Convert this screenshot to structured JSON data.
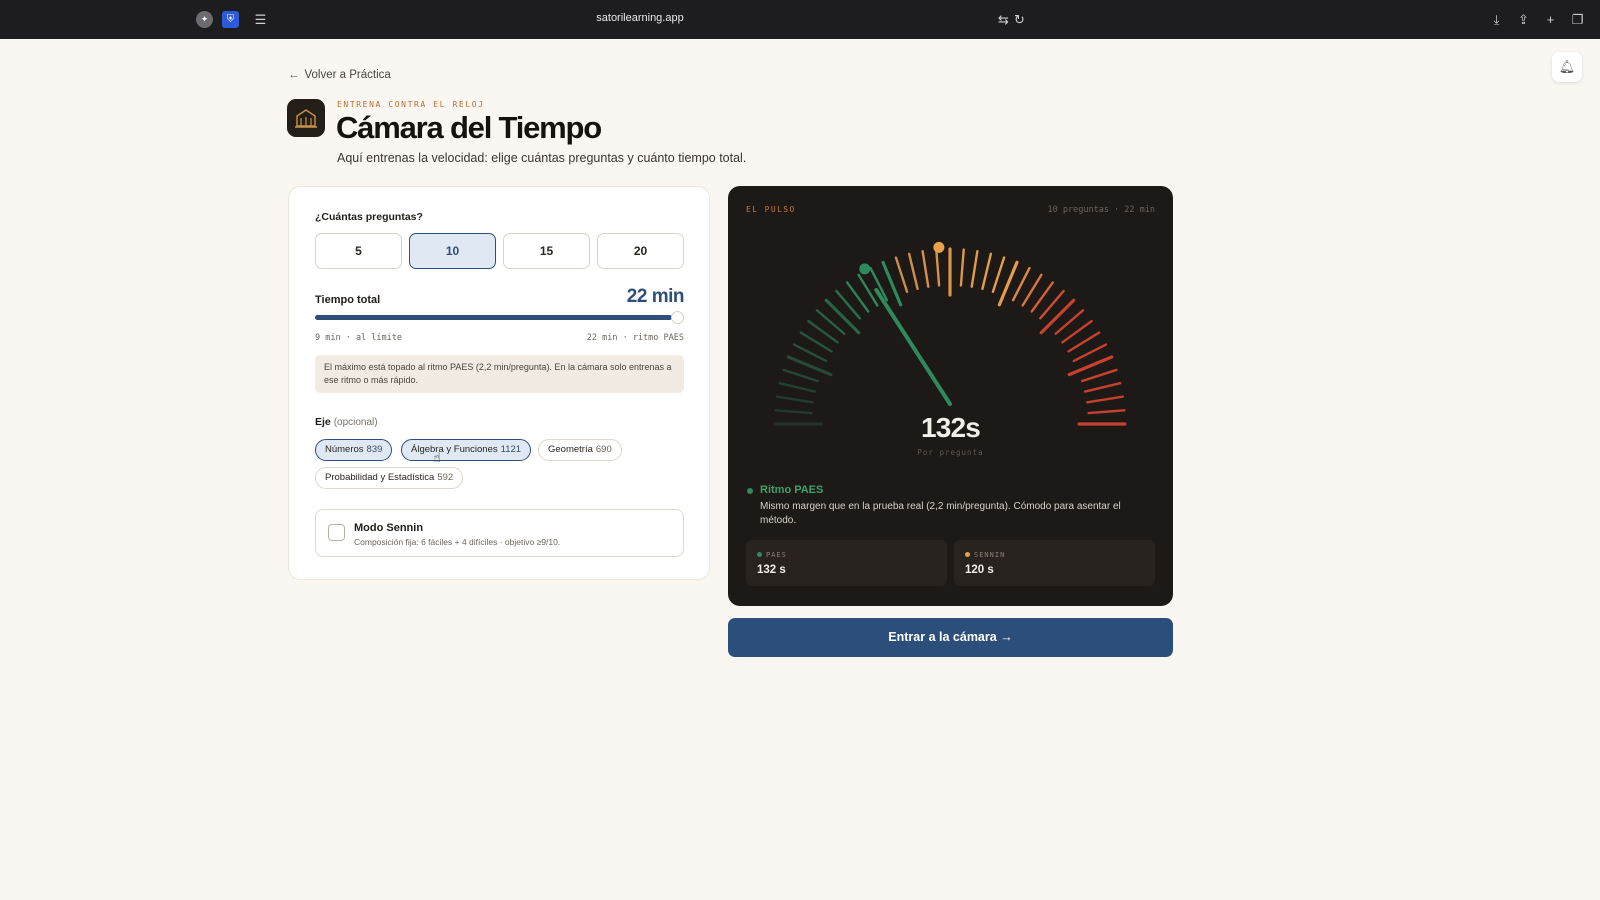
{
  "browser": {
    "url": "satorilearning.app"
  },
  "nav": {
    "back_label": "Volver a Práctica"
  },
  "header": {
    "kicker": "ENTRENA CONTRA EL RELOJ",
    "title": "Cámara del Tiempo",
    "subtitle": "Aquí entrenas la velocidad: elige cuántas preguntas y cuánto tiempo total."
  },
  "config": {
    "questions_label": "¿Cuántas preguntas?",
    "question_options": [
      "5",
      "10",
      "15",
      "20"
    ],
    "selected_questions": "10",
    "total_time_label": "Tiempo total",
    "total_time_value": "22 min",
    "time_slider": {
      "min_label": "9 min · al límite",
      "max_label": "22 min · ritmo PAES",
      "value_fraction": 1.0
    },
    "note": "El máximo está topado al ritmo PAES (2,2 min/pregunta). En la cámara solo entrenas a ese ritmo o más rápido.",
    "eje_label": "Eje",
    "eje_optional": "(opcional)",
    "chips": [
      {
        "label": "Números",
        "count": "839",
        "selected": true
      },
      {
        "label": "Álgebra y Funciones",
        "count": "1121",
        "selected": true
      },
      {
        "label": "Geometría",
        "count": "690",
        "selected": false
      },
      {
        "label": "Probabilidad y Estadística",
        "count": "592",
        "selected": false
      }
    ],
    "sennin": {
      "name": "Modo Sennin",
      "description": "Composición fija: 6 fáciles + 4 difíciles · objetivo ≥9/10.",
      "checked": false
    }
  },
  "pulse": {
    "kicker": "EL PULSO",
    "meta": "10 preguntas · 22 min",
    "gauge": {
      "value": "132s",
      "sub": "Por pregunta",
      "needle_fraction": 0.34,
      "paes_fraction": 0.34,
      "sennin_fraction": 0.48
    },
    "rhythm_title": "Ritmo PAES",
    "rhythm_desc": "Mismo margen que en la prueba real (2,2 min/pregunta). Cómodo para asentar el método.",
    "stats": [
      {
        "key": "PAES",
        "value": "132 s",
        "color": "#2e8a5e"
      },
      {
        "key": "SENNIN",
        "value": "120 s",
        "color": "#e8a04a"
      }
    ]
  },
  "cta": {
    "label": "Entrar a la cámara"
  },
  "colors": {
    "accent": "#2c4e7a",
    "green": "#2e8a5e",
    "orange": "#e8a04a",
    "red": "#c8402e"
  }
}
